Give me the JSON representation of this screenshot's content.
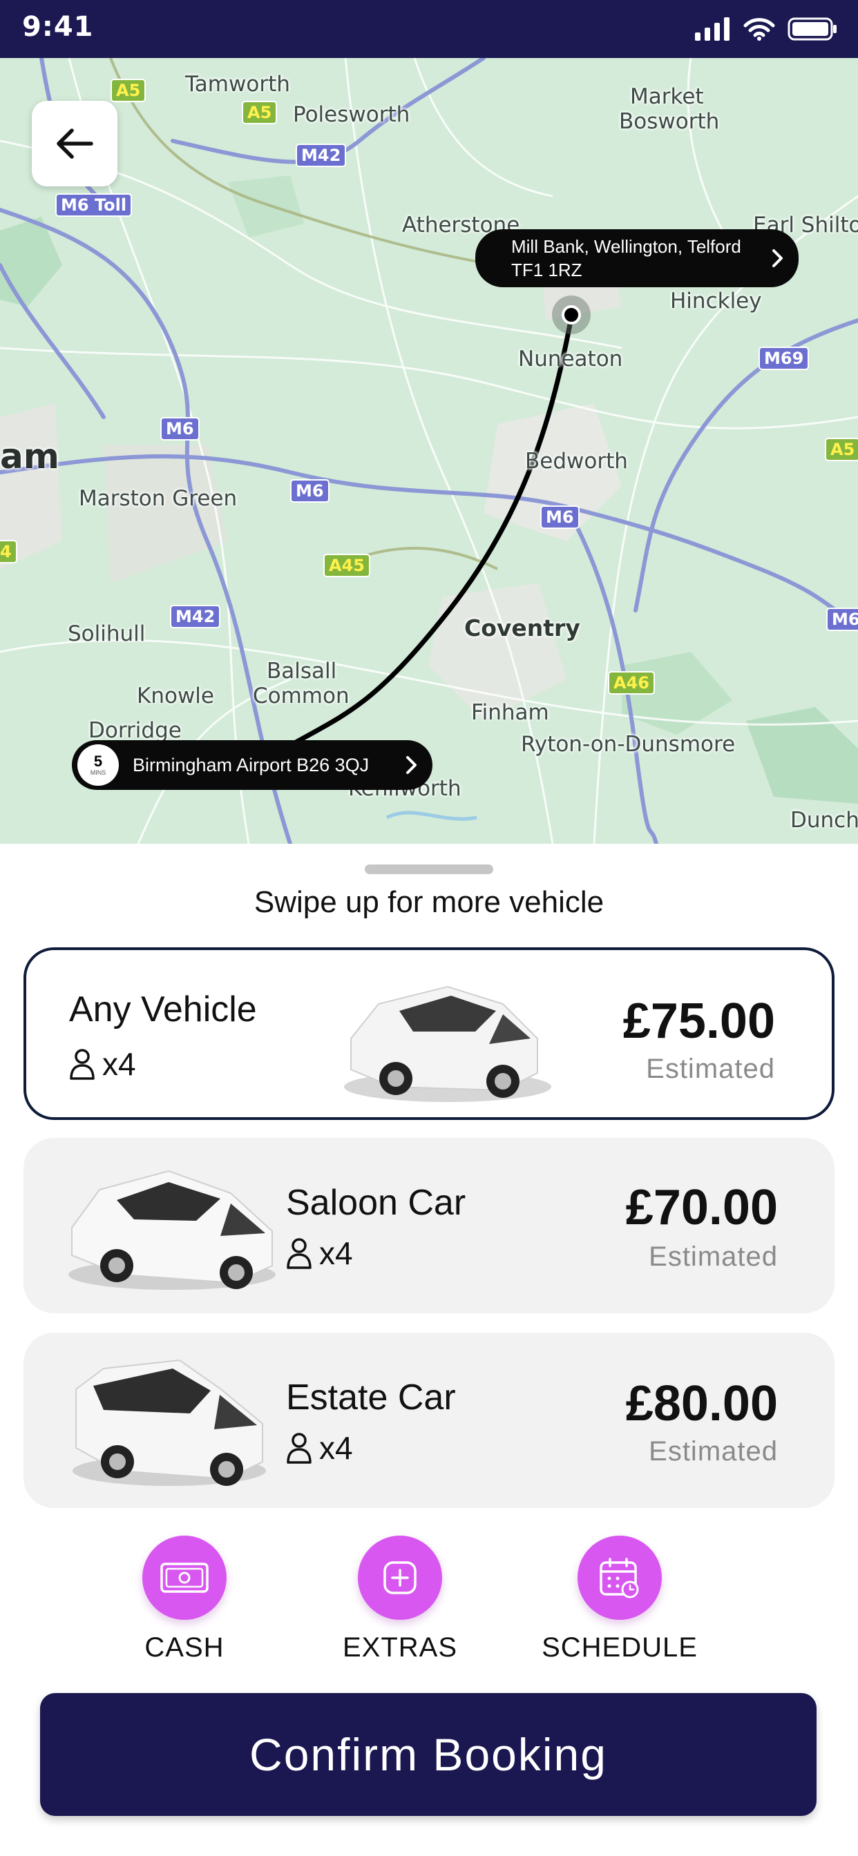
{
  "status_bar": {
    "time": "9:41"
  },
  "map": {
    "places": [
      {
        "name": "Tamworth",
        "style": "normal"
      },
      {
        "name": "Polesworth",
        "style": "normal"
      },
      {
        "name": "Market",
        "style": "normal"
      },
      {
        "name": "Bosworth",
        "style": "normal"
      },
      {
        "name": "Atherstone",
        "style": "normal"
      },
      {
        "name": "Earl Shilton",
        "style": "normal"
      },
      {
        "name": "Hinckley",
        "style": "normal"
      },
      {
        "name": "Nuneaton",
        "style": "normal"
      },
      {
        "name": "Bedworth",
        "style": "normal"
      },
      {
        "name": "am",
        "style": "big"
      },
      {
        "name": "Marston Green",
        "style": "normal"
      },
      {
        "name": "Coventry",
        "style": "bold"
      },
      {
        "name": "Solihull",
        "style": "normal"
      },
      {
        "name": "Balsall",
        "style": "normal"
      },
      {
        "name": "Common",
        "style": "normal"
      },
      {
        "name": "Knowle",
        "style": "normal"
      },
      {
        "name": "Dorridge",
        "style": "normal"
      },
      {
        "name": "Finham",
        "style": "normal"
      },
      {
        "name": "Ryton-on-Dunsmore",
        "style": "normal"
      },
      {
        "name": "Kenilworth",
        "style": "normal"
      },
      {
        "name": "Dunch",
        "style": "normal"
      }
    ],
    "road_shields": [
      {
        "label": "A5",
        "color": "green"
      },
      {
        "label": "A5",
        "color": "green"
      },
      {
        "label": "M42",
        "color": "blue"
      },
      {
        "label": "M6 Toll",
        "color": "blue"
      },
      {
        "label": "M69",
        "color": "blue"
      },
      {
        "label": "A5",
        "color": "green"
      },
      {
        "label": "M6",
        "color": "blue"
      },
      {
        "label": "M6",
        "color": "blue"
      },
      {
        "label": "M6",
        "color": "blue"
      },
      {
        "label": "A45",
        "color": "green"
      },
      {
        "label": "M42",
        "color": "blue"
      },
      {
        "label": "A46",
        "color": "green"
      },
      {
        "label": "M6",
        "color": "blue"
      },
      {
        "label": "4",
        "color": "green"
      }
    ],
    "destination": {
      "line1": "Mill Bank, Wellington, Telford",
      "line2": "TF1 1RZ"
    },
    "origin": {
      "label": "Birmingham Airport B26 3QJ",
      "eta_value": "5",
      "eta_unit": "MINS"
    }
  },
  "sheet": {
    "swipe_hint": "Swipe up for more vehicle",
    "vehicles": [
      {
        "name": "Any Vehicle",
        "passengers": "x4",
        "price": "£75.00",
        "price_note": "Estimated",
        "selected": true
      },
      {
        "name": "Saloon Car",
        "passengers": "x4",
        "price": "£70.00",
        "price_note": "Estimated",
        "selected": false
      },
      {
        "name": "Estate Car",
        "passengers": "x4",
        "price": "£80.00",
        "price_note": "Estimated",
        "selected": false
      }
    ],
    "actions": [
      {
        "label": "CASH",
        "icon": "cash-icon"
      },
      {
        "label": "EXTRAS",
        "icon": "plus-icon"
      },
      {
        "label": "SCHEDULE",
        "icon": "calendar-icon"
      }
    ],
    "confirm_label": "Confirm Booking"
  },
  "colors": {
    "status_bar": "#1b1852",
    "accent_purple": "#d857f0",
    "confirm_button": "#1b1750",
    "selected_border": "#0f1b3a"
  }
}
